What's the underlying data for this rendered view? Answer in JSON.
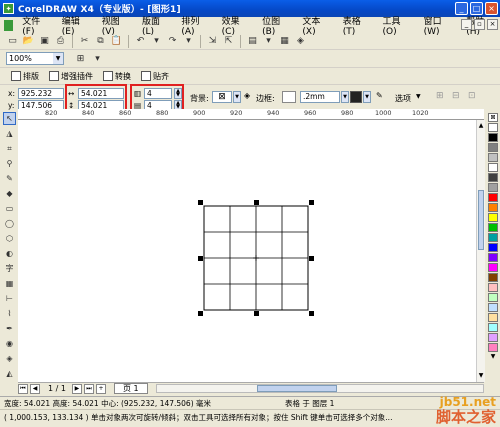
{
  "window": {
    "title": "CorelDRAW X4（专业版）- [图形1]"
  },
  "menu": [
    "文件(F)",
    "编辑(E)",
    "视图(V)",
    "版面(L)",
    "排列(A)",
    "效果(C)",
    "位图(B)",
    "文本(X)",
    "表格(T)",
    "工具(O)",
    "窗口(W)",
    "帮助(H)"
  ],
  "zoom": {
    "value": "100%"
  },
  "table_tabs": [
    "排版",
    "增强插件",
    "转换",
    "贴齐"
  ],
  "props": {
    "x": "925.232 mm",
    "y": "147.506 mm",
    "width": "54.021 mm",
    "height": "54.021 mm",
    "cols": "4",
    "rows": "4",
    "bg_label": "背景:",
    "border_label": "边框:",
    "border_width": ".2mm",
    "options_label": "选项"
  },
  "ruler": {
    "labels": [
      "820",
      "840",
      "860",
      "880",
      "900",
      "920",
      "940",
      "960",
      "980",
      "1000",
      "1020"
    ]
  },
  "pages": {
    "counter": "1 / 1",
    "tab": "页 1"
  },
  "status": {
    "line1": "宽度: 54.021 高度: 54.021 中心: (925.232, 147.506) 毫米",
    "line1_right": "表格 于 图层 1",
    "line2": "( 1,000.153, 133.134 ) 单击对象两次可旋转/倾斜；双击工具可选择所有对象；按住 Shift 键单击可选择多个对象..."
  },
  "watermark": {
    "line1": "jb51.net",
    "line2": "脚本之家"
  },
  "palette_colors": [
    "#ffffff",
    "#000000",
    "#808080",
    "#c0c0c0",
    "#ff0000",
    "#ff8000",
    "#ffff00",
    "#00c000",
    "#008080",
    "#0000ff",
    "#8000ff",
    "#ff00ff",
    "#804000",
    "#ffc0c0",
    "#c0ffc0"
  ]
}
